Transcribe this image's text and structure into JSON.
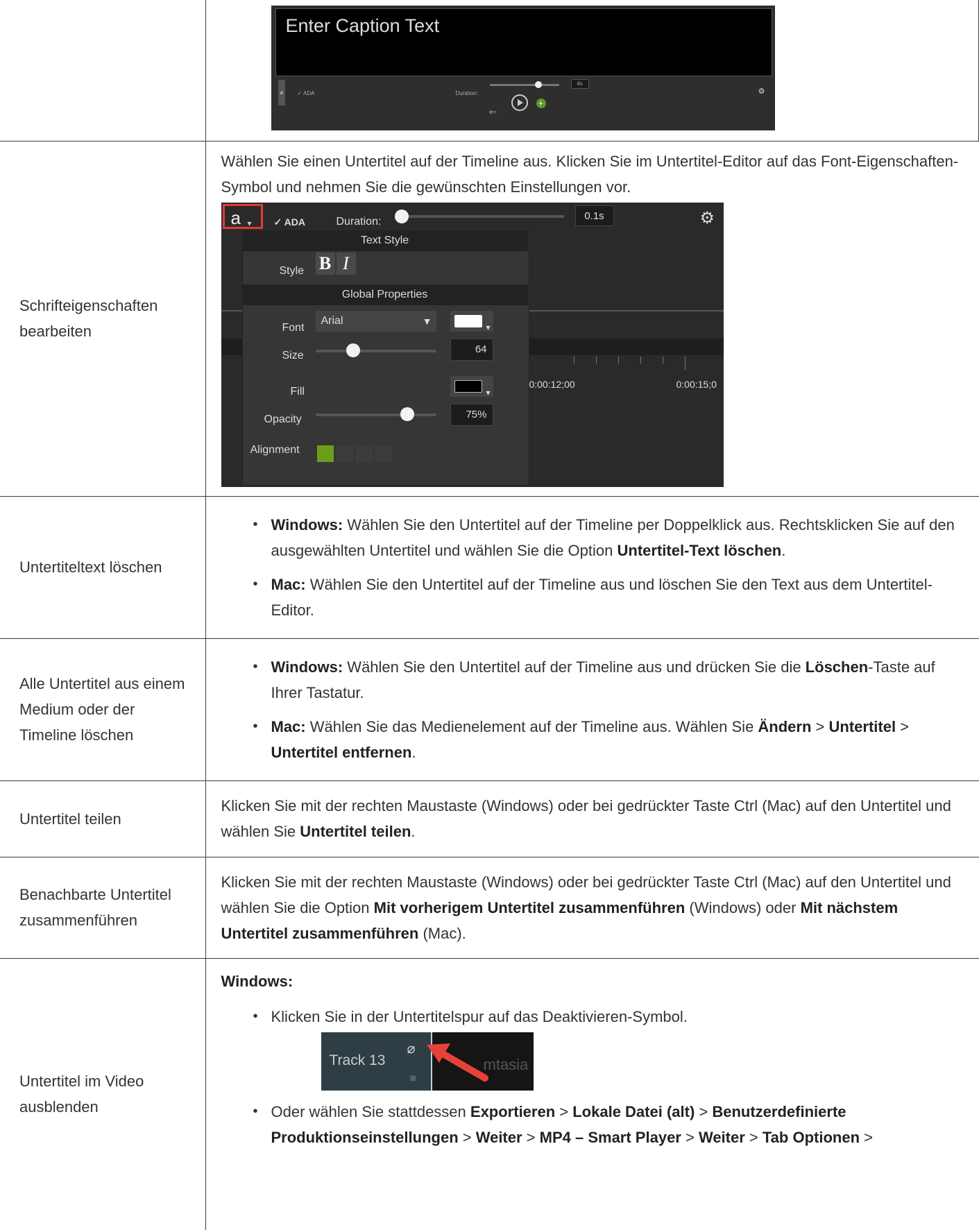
{
  "screenshot1": {
    "caption_placeholder": "Enter Caption Text",
    "font_btn": "a",
    "ada_label": "✓ ADA",
    "duration_label": "Duration:",
    "duration_value": "4s"
  },
  "rows": [
    {
      "label": "Schrifteigenschaften bearbeiten",
      "text": "Wählen Sie einen Untertitel auf der Timeline aus. Klicken Sie im Untertitel-Editor auf das Font-Eigenschaften-Symbol und nehmen Sie die gewünschten Einstellungen vor."
    },
    {
      "label": "Untertiteltext löschen",
      "b1_os": "Windows:",
      "b1_text": " Wählen Sie den Untertitel auf der Timeline per Doppelklick aus. Rechtsklicken Sie auf den ausgewählten Untertitel und wählen Sie die Option ",
      "b1_bold": "Untertitel-Text löschen",
      "b1_end": ".",
      "b2_os": "Mac:",
      "b2_text": " Wählen Sie den Untertitel auf der Timeline aus und löschen Sie den Text aus dem Untertitel-Editor."
    },
    {
      "label": "Alle Untertitel aus einem Medium oder der Timeline löschen",
      "b1_os": "Windows:",
      "b1_text": " Wählen Sie den Untertitel auf der Timeline aus und drücken Sie die ",
      "b1_bold": "Löschen",
      "b1_end": "-Taste auf Ihrer Tastatur.",
      "b2_os": "Mac:",
      "b2_text": " Wählen Sie das Medienelement auf der Timeline aus. Wählen Sie ",
      "b2_bold1": "Ändern",
      "b2_sep1": " > ",
      "b2_bold2": "Untertitel",
      "b2_sep2": " > ",
      "b2_bold3": "Untertitel entfernen",
      "b2_end": "."
    },
    {
      "label": "Untertitel teilen",
      "text": "Klicken Sie mit der rechten Maustaste (Windows) oder bei gedrückter Taste Ctrl (Mac) auf den Untertitel und wählen Sie ",
      "bold": "Untertitel teilen",
      "end": "."
    },
    {
      "label": "Benachbarte Untertitel zusammenführen",
      "text": "Klicken Sie mit der rechten Maustaste (Windows) oder bei gedrückter Taste Ctrl (Mac) auf den Untertitel und wählen Sie die Option ",
      "bold1": "Mit vorherigem Untertitel zusammenführen",
      "mid": " (Windows) oder ",
      "bold2": "Mit nächstem Untertitel zusammenführen",
      "end": " (Mac)."
    },
    {
      "label": "Untertitel im Video ausblenden",
      "heading": "Windows:",
      "b1": "Klicken Sie in der Untertitelspur auf das Deaktivieren-Symbol.",
      "b2_pre": "Oder wählen Sie stattdessen ",
      "b2_s1": "Exportieren",
      "b2_s2": "Lokale Datei (alt)",
      "b2_s3": "Benutzerdefinierte Produktionseinstellungen",
      "b2_s4": "Weiter",
      "b2_s5": "MP4 – Smart Player",
      "b2_s6": "Weiter",
      "b2_s7": "Tab Optionen",
      "sep": " > "
    }
  ],
  "text_style_panel": {
    "font_btn": "a",
    "ada_label": "✓ ADA",
    "duration_label": "Duration:",
    "duration_value": "0.1s",
    "text_style_header": "Text Style",
    "style_label": "Style",
    "bold_btn": "B",
    "italic_btn": "I",
    "global_header": "Global Properties",
    "font_label": "Font",
    "font_value": "Arial",
    "size_label": "Size",
    "size_value": "64",
    "size_level": 0.27,
    "fill_label": "Fill",
    "opacity_label": "Opacity",
    "opacity_value": "75%",
    "alignment_label": "Alignment",
    "time1": "0:00:12;00",
    "time2": "0:00:15;0",
    "highlight_color": "#e53935",
    "accent_green": "#6a9f1a"
  },
  "track_shot": {
    "track_label": "Track 13",
    "bg_text": "mtasia",
    "arrow_color": "#e8413a"
  }
}
